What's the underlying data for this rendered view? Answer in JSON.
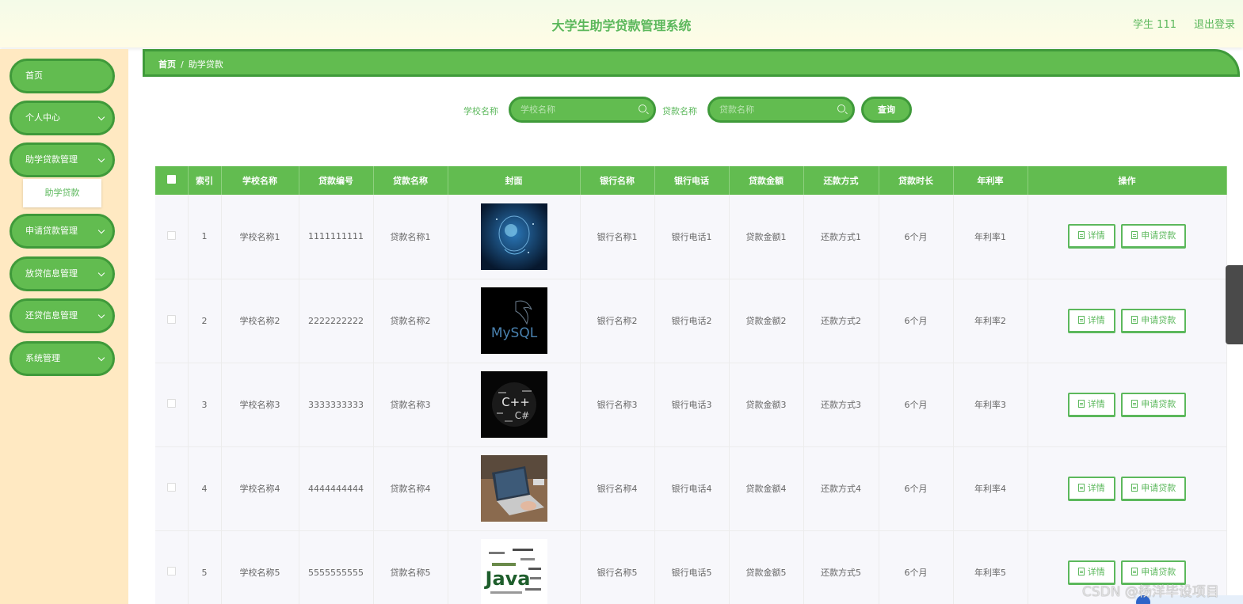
{
  "header": {
    "title": "大学生助学贷款管理系统",
    "user": "学生 111",
    "logout": "退出登录"
  },
  "sidebar": {
    "items": [
      {
        "label": "首页"
      },
      {
        "label": "个人中心"
      },
      {
        "label": "助学贷款管理"
      },
      {
        "label": "申请贷款管理"
      },
      {
        "label": "放贷信息管理"
      },
      {
        "label": "还贷信息管理"
      },
      {
        "label": "系统管理"
      }
    ],
    "submenu_active": "助学贷款"
  },
  "breadcrumb": {
    "home": "首页",
    "separator": "/",
    "current": "助学贷款"
  },
  "search": {
    "school_label": "学校名称",
    "school_placeholder": "学校名称",
    "loan_label": "贷款名称",
    "loan_placeholder": "贷款名称",
    "query_button": "查询"
  },
  "table": {
    "headers": [
      "索引",
      "学校名称",
      "贷款编号",
      "贷款名称",
      "封面",
      "银行名称",
      "银行电话",
      "贷款金额",
      "还款方式",
      "贷款时长",
      "年利率",
      "操作"
    ],
    "rows": [
      {
        "index": "1",
        "school": "学校名称1",
        "code": "1111111111",
        "name": "贷款名称1",
        "cover": "ai-head-image",
        "bank": "银行名称1",
        "phone": "银行电话1",
        "amount": "贷款金额1",
        "repay": "还款方式1",
        "duration": "6个月",
        "rate": "年利率1"
      },
      {
        "index": "2",
        "school": "学校名称2",
        "code": "2222222222",
        "name": "贷款名称2",
        "cover": "mysql-logo-image",
        "bank": "银行名称2",
        "phone": "银行电话2",
        "amount": "贷款金额2",
        "repay": "还款方式2",
        "duration": "6个月",
        "rate": "年利率2"
      },
      {
        "index": "3",
        "school": "学校名称3",
        "code": "3333333333",
        "name": "贷款名称3",
        "cover": "cpp-word-cloud-image",
        "bank": "银行名称3",
        "phone": "银行电话3",
        "amount": "贷款金额3",
        "repay": "还款方式3",
        "duration": "6个月",
        "rate": "年利率3"
      },
      {
        "index": "4",
        "school": "学校名称4",
        "code": "4444444444",
        "name": "贷款名称4",
        "cover": "laptop-photo-image",
        "bank": "银行名称4",
        "phone": "银行电话4",
        "amount": "贷款金额4",
        "repay": "还款方式4",
        "duration": "6个月",
        "rate": "年利率4"
      },
      {
        "index": "5",
        "school": "学校名称5",
        "code": "5555555555",
        "name": "贷款名称5",
        "cover": "java-word-cloud-image",
        "bank": "银行名称5",
        "phone": "银行电话5",
        "amount": "贷款金额5",
        "repay": "还款方式5",
        "duration": "6个月",
        "rate": "年利率5"
      }
    ],
    "actions": {
      "detail": "详情",
      "apply": "申请贷款"
    }
  },
  "cover_text": {
    "mysql": "MySQL",
    "cpp": "C++",
    "csharp": "C#",
    "java": "Java"
  },
  "watermark": "CSDN @杨洋毕设项目",
  "colors": {
    "primary": "#62bc50",
    "primary_dark": "#3f9a3a",
    "sidebar_bg": "#ffe9c2",
    "text_green": "#5cb85c"
  }
}
